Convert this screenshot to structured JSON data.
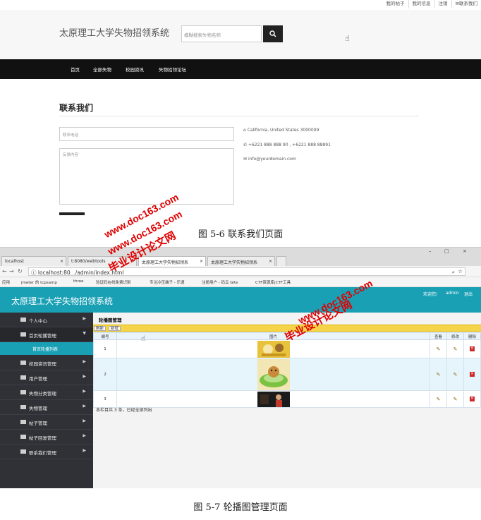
{
  "fig1": {
    "topbar": [
      "我的帖子",
      "我的信息",
      "注销",
      "✉联系我们"
    ],
    "site_title": "太原理工大学失物招领系统",
    "search_placeholder": "模糊搜索失物名称",
    "nav": [
      "首页",
      "全部失物",
      "校园资讯",
      "失物招领论坛"
    ],
    "contact_title": "联系我们",
    "phone_placeholder": "联系电话",
    "message_placeholder": "反馈内容",
    "address": "California, United States 3000009",
    "phones": "+6221 888 888 90 , +6221 888 88891",
    "email": "info@yourdomain.com",
    "caption": "图 5-6 联系我们页面"
  },
  "watermark": {
    "line1": "毕业设计论文网",
    "line2": "www.doc163.com",
    "color": "#e00000"
  },
  "fig2": {
    "tabs": [
      "localhost",
      "t:8080/webtools",
      "太原理工大学失物招领系",
      "太原理工大学失物招领系"
    ],
    "url_host": "localhost:80",
    "url_path": "/admin/index.html",
    "bookmarks": [
      "应用",
      "jmeter 的 tcpsamp",
      "three",
      "验证码在线免费识别",
      "专注冷压端子 - 乐速",
      "注册用户 - 码云 Gite",
      "CTF资源库|CTF工具"
    ],
    "app_title": "太原理工大学失物招领系统",
    "header_links": [
      "欢迎您!",
      "admin",
      "退出"
    ],
    "sidebar": [
      "个人中心",
      "首页轮播管理",
      "校园资讯管理",
      "用户管理",
      "失物分类管理",
      "失物管理",
      "帖子管理",
      "帖子回复管理",
      "联系我们管理"
    ],
    "sidebar_sub": "首页轮播列表",
    "breadcrumb": "轮播图管理",
    "toolbar": [
      "刷新",
      "新增"
    ],
    "columns": [
      "编号",
      "图片",
      "查看",
      "修改",
      "删除"
    ],
    "rows": [
      {
        "id": "1"
      },
      {
        "id": "2"
      },
      {
        "id": "3"
      }
    ],
    "footnote": "本栏目共 3 条，已经全部列出",
    "caption": "图 5-7 轮播图管理页面"
  }
}
